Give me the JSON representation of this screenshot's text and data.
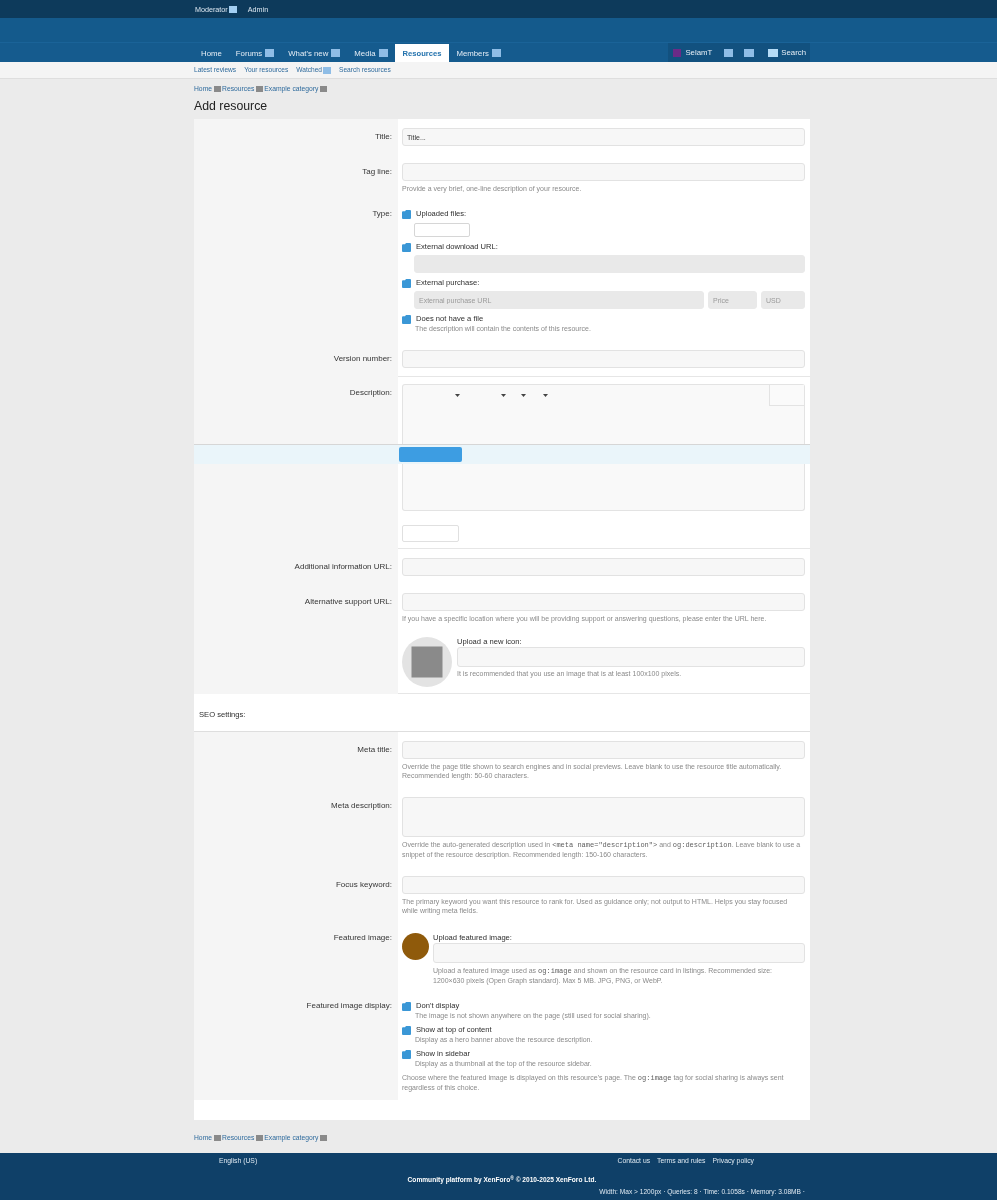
{
  "top_bar": {
    "links": [
      {
        "label": "Moderator",
        "has_menu": true
      },
      {
        "label": "Admin",
        "has_menu": false
      }
    ]
  },
  "nav": {
    "tabs": [
      {
        "label": "Home",
        "selected": false,
        "has_menu": false
      },
      {
        "label": "Forums",
        "selected": false,
        "has_menu": true
      },
      {
        "label": "What's new",
        "selected": false,
        "has_menu": true
      },
      {
        "label": "Media",
        "selected": false,
        "has_menu": true
      },
      {
        "label": "Resources",
        "selected": true,
        "has_menu": false
      },
      {
        "label": "Members",
        "selected": false,
        "has_menu": true
      }
    ],
    "user": {
      "name": "SelamT"
    },
    "search": {
      "label": "Search"
    }
  },
  "subnav": [
    {
      "label": "Latest reviews",
      "has_menu": false
    },
    {
      "label": "Your resources",
      "has_menu": false
    },
    {
      "label": "Watched",
      "has_menu": true
    },
    {
      "label": "Search resources",
      "has_menu": false
    }
  ],
  "breadcrumb": [
    "Home",
    "Resources",
    "Example category"
  ],
  "page_title": "Add resource",
  "form": {
    "rows": [
      {
        "kind": "input",
        "label": "Title:",
        "placeholder": "Title..."
      },
      {
        "kind": "input",
        "label": "Tag line:",
        "hint": "Provide a very brief, one-line description of your resource."
      },
      {
        "kind": "choices",
        "label": "Type:",
        "options": [
          {
            "kind": "upload",
            "label": "Uploaded files:",
            "disabled": false
          },
          {
            "kind": "url",
            "label": "External download URL:",
            "disabled": true
          },
          {
            "kind": "purchase",
            "label": "External purchase:",
            "disabled": true,
            "placeholders": [
              "External purchase URL",
              "Price",
              "USD"
            ]
          },
          {
            "kind": "plain",
            "label": "Does not have a file",
            "hint": "The description will contain the contents of this resource."
          }
        ]
      },
      {
        "kind": "input",
        "label": "Version number:"
      },
      {
        "kind": "editor",
        "label": "Description:"
      },
      {
        "kind": "input",
        "label": "Additional information URL:"
      },
      {
        "kind": "input",
        "label": "Alternative support URL:",
        "hint": "If you have a specific location where you will be providing support or answering questions, please enter the URL here."
      },
      {
        "kind": "icon_upload",
        "upload_label": "Upload a new icon:",
        "hint": "It is recommended that you use an image that is at least 100x100 pixels."
      },
      {
        "kind": "section",
        "label": "SEO settings:"
      },
      {
        "kind": "input",
        "label": "Meta title:",
        "hint": "Override the page title shown to search engines and in social previews. Leave blank to use the resource title automatically. Recommended length: 50-60 characters."
      },
      {
        "kind": "textarea",
        "label": "Meta description:",
        "hint": [
          {
            "text": "Override the auto-generated description used in ",
            "code": false
          },
          {
            "text": "<meta name=\"description\">",
            "code": true
          },
          {
            "text": " and ",
            "code": false
          },
          {
            "text": "og:description",
            "code": true
          },
          {
            "text": ". Leave blank to use a snippet of the resource description. Recommended length: 150-160 characters.",
            "code": false
          }
        ]
      },
      {
        "kind": "input",
        "label": "Focus keyword:",
        "hint": "The primary keyword you want this resource to rank for. Used as guidance only; not output to HTML. Helps you stay focused while writing meta fields."
      },
      {
        "kind": "image_upload",
        "label": "Featured image:",
        "upload_label": "Upload featured image:",
        "hint": [
          {
            "text": "Upload a featured image used as ",
            "code": false
          },
          {
            "text": "og:image",
            "code": true
          },
          {
            "text": " and shown on the resource card in listings. Recommended size: 1200×630 pixels (Open Graph standard). Max 5 MB. JPG, PNG, or WebP.",
            "code": false
          }
        ]
      },
      {
        "kind": "choices",
        "label": "Featured image display:",
        "options": [
          {
            "kind": "plain",
            "label": "Don't display",
            "hint": "The image is not shown anywhere on the page (still used for social sharing)."
          },
          {
            "kind": "plain",
            "label": "Show at top of content",
            "hint": "Display as a hero banner above the resource description."
          },
          {
            "kind": "plain",
            "label": "Show in sidebar",
            "hint": "Display as a thumbnail at the top of the resource sidebar."
          }
        ],
        "hint": [
          {
            "text": "Choose where the featured image is displayed on this resource's page. The ",
            "code": false
          },
          {
            "text": "og:image",
            "code": true
          },
          {
            "text": " tag for social sharing is always sent regardless of this choice.",
            "code": false
          }
        ]
      }
    ]
  },
  "bottom_breadcrumb": [
    "Home",
    "Resources",
    "Example category"
  ],
  "footer": {
    "language": "English (US)",
    "links": [
      "Contact us",
      "Terms and rules",
      "Privacy policy"
    ],
    "copyright": "Community platform by XenForo$^{®}$ © 2010-2025 XenForo Ltd.",
    "debug": "Width: Max > 1200px · Queries: 8 · Time: 0.1058s · Memory: 3.08MB ·"
  }
}
